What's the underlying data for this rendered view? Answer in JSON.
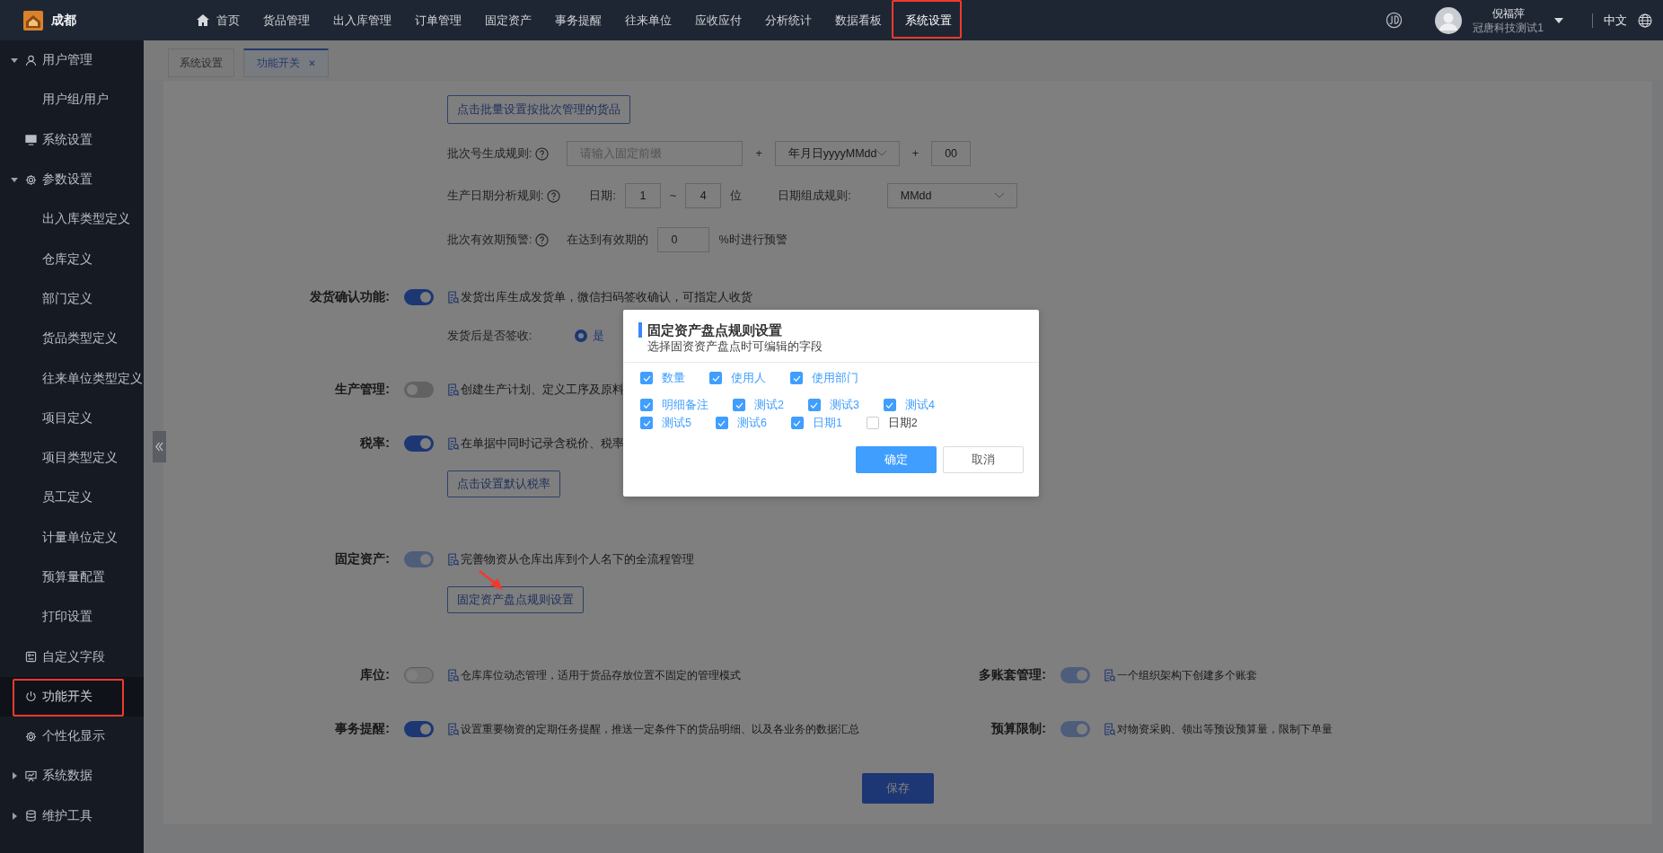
{
  "top_bar": {
    "brand": "成都",
    "nav": [
      {
        "label": "首页",
        "selected": false
      },
      {
        "label": "货品管理",
        "selected": false
      },
      {
        "label": "出入库管理",
        "selected": false
      },
      {
        "label": "订单管理",
        "selected": false
      },
      {
        "label": "固定资产",
        "selected": false
      },
      {
        "label": "事务提醒",
        "selected": false
      },
      {
        "label": "往来单位",
        "selected": false
      },
      {
        "label": "应收应付",
        "selected": false
      },
      {
        "label": "分析统计",
        "selected": false
      },
      {
        "label": "数据看板",
        "selected": false
      },
      {
        "label": "系统设置",
        "selected": true
      }
    ],
    "user": {
      "name": "倪福萍",
      "company": "冠唐科技测试1"
    },
    "language": "中文"
  },
  "sidebar": {
    "items": [
      {
        "label": "用户管理",
        "expanded": true,
        "selected": false,
        "children": [
          {
            "label": "用户组/用户",
            "selected": false
          }
        ]
      },
      {
        "label": "系统设置",
        "selected": false
      },
      {
        "label": "参数设置",
        "expanded": true,
        "selected": false,
        "children": [
          {
            "label": "出入库类型定义",
            "selected": false
          },
          {
            "label": "仓库定义",
            "selected": false
          },
          {
            "label": "部门定义",
            "selected": false
          },
          {
            "label": "货品类型定义",
            "selected": false
          },
          {
            "label": "往来单位类型定义",
            "selected": false
          },
          {
            "label": "项目定义",
            "selected": false
          },
          {
            "label": "项目类型定义",
            "selected": false
          },
          {
            "label": "员工定义",
            "selected": false
          },
          {
            "label": "计量单位定义",
            "selected": false
          },
          {
            "label": "预算量配置",
            "selected": false
          },
          {
            "label": "打印设置",
            "selected": false
          }
        ]
      },
      {
        "label": "自定义字段",
        "selected": false
      },
      {
        "label": "功能开关",
        "selected": true
      },
      {
        "label": "个性化显示",
        "selected": false
      },
      {
        "label": "系统数据",
        "expanded": false,
        "selected": false
      },
      {
        "label": "维护工具",
        "expanded": false,
        "selected": false
      }
    ]
  },
  "tabs": [
    {
      "label": "系统设置",
      "selected": false,
      "closable": false
    },
    {
      "label": "功能开关",
      "selected": true,
      "closable": true
    }
  ],
  "batch_button": "点击批量设置按批次管理的货品",
  "batch_number_rule": {
    "label": "批次号生成规则:",
    "prefix_placeholder": "请输入固定前缀",
    "plus_1": "+",
    "date_format": "年月日yyyyMMdd",
    "plus_2": "+",
    "serial": "00"
  },
  "production_date_rule": {
    "label": "生产日期分析规则:",
    "date_label": "日期:",
    "from": "1",
    "tilde": "~",
    "to": "4",
    "unit": "位",
    "compose_label": "日期组成规则:",
    "compose_value": "MMdd"
  },
  "expiry_warning": {
    "label": "批次有效期预警:",
    "prefix": "在达到有效期的",
    "percent": "0",
    "suffix": "%时进行预警"
  },
  "features": [
    {
      "label": "发货确认功能:",
      "on": true,
      "disabled": false,
      "description": "发货出库生成发货单，微信扫码签收确认，可指定人收货",
      "sub_label": "发货后是否签收:",
      "sub_option": {
        "label": "是",
        "selected": true
      }
    },
    {
      "label": "生产管理:",
      "on": false,
      "disabled": false,
      "description": "创建生产计划、定义工序及原料"
    },
    {
      "label": "税率:",
      "on": true,
      "disabled": false,
      "description": "在单据中同时记录含税价、税率",
      "button": "点击设置默认税率"
    },
    {
      "label": "固定资产:",
      "on": true,
      "disabled": true,
      "description": "完善物资从仓库出库到个人名下的全流程管理",
      "button": "固定资产盘点规则设置"
    }
  ],
  "paired_features": [
    [
      {
        "label": "库位:",
        "on": false,
        "disabled": true,
        "description": "仓库库位动态管理，适用于货品存放位置不固定的管理模式"
      },
      {
        "label": "多账套管理:",
        "on": true,
        "disabled": true,
        "description": "一个组织架构下创建多个账套"
      }
    ],
    [
      {
        "label": "事务提醒:",
        "on": true,
        "disabled": false,
        "description": "设置重要物资的定期任务提醒，推送一定条件下的货品明细、以及各业务的数据汇总"
      },
      {
        "label": "预算限制:",
        "on": true,
        "disabled": true,
        "description": "对物资采购、领出等预设预算量，限制下单量"
      }
    ]
  ],
  "save": "保存",
  "dialog": {
    "title": "固定资产盘点规则设置",
    "subtitle": "选择固资资产盘点时可编辑的字段",
    "field_rows": [
      [
        {
          "label": "数量",
          "checked": true
        },
        {
          "label": "使用人",
          "checked": true
        },
        {
          "label": "使用部门",
          "checked": true
        }
      ],
      [
        {
          "label": "明细备注",
          "checked": true
        },
        {
          "label": "测试2",
          "checked": true
        },
        {
          "label": "测试3",
          "checked": true
        },
        {
          "label": "测试4",
          "checked": true
        }
      ],
      [
        {
          "label": "测试5",
          "checked": true
        },
        {
          "label": "测试6",
          "checked": true
        },
        {
          "label": "日期1",
          "checked": true
        },
        {
          "label": "日期2",
          "checked": false
        }
      ]
    ],
    "confirm": "确定",
    "cancel": "取消"
  }
}
